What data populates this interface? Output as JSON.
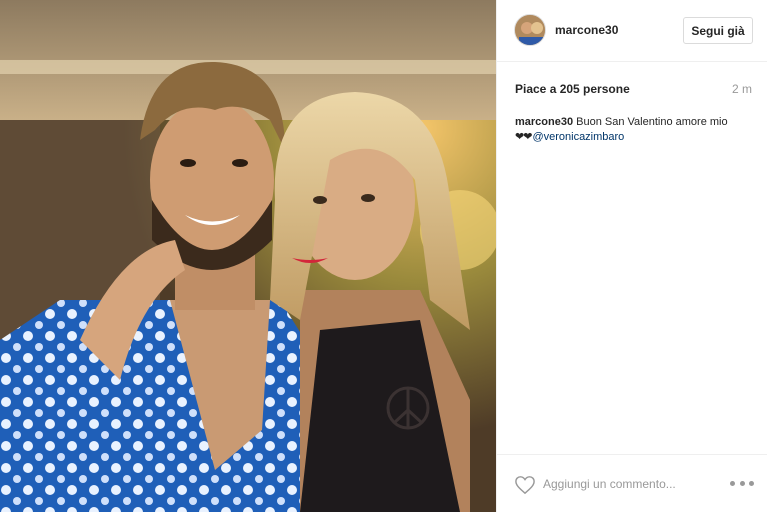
{
  "post": {
    "username": "marcone30",
    "follow_label": "Segui già",
    "likes_text": "Piace a 205 persone",
    "time_ago": "2 m",
    "caption": {
      "username": "marcone30",
      "text": "Buon San Valentino amore mio",
      "hearts": "❤❤",
      "mention": "@veronicazimbaro"
    },
    "comment_placeholder": "Aggiungi un commento...",
    "photo_icon": "photo",
    "like_icon": "heart-outline-icon",
    "more_icon": "more-options-icon"
  }
}
